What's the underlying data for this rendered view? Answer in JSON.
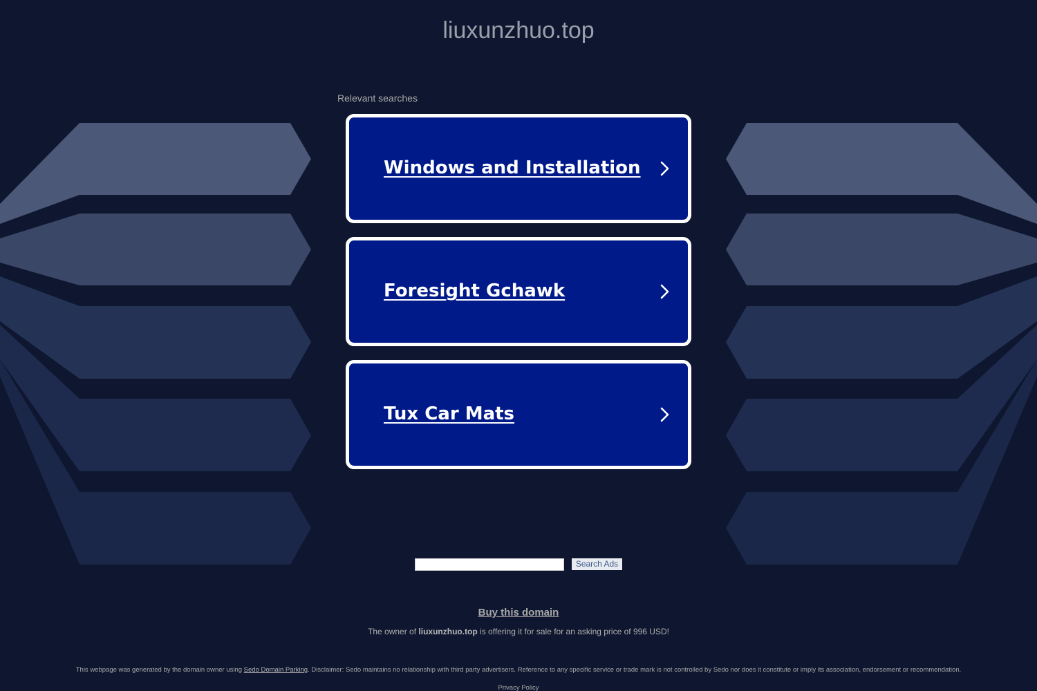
{
  "header": {
    "domain_title": "liuxunzhuo.top"
  },
  "relevant_searches": {
    "label": "Relevant searches",
    "items": [
      {
        "label": "Windows and Installation",
        "icon": "chevron-right-icon"
      },
      {
        "label": "Foresight Gchawk",
        "icon": "chevron-right-icon"
      },
      {
        "label": "Tux Car Mats",
        "icon": "chevron-right-icon"
      }
    ]
  },
  "search": {
    "input_value": "",
    "button_label": "Search Ads"
  },
  "sale": {
    "buy_link": "Buy this domain",
    "text_prefix": "The owner of ",
    "domain": "liuxunzhuo.top",
    "text_suffix": " is offering it for sale for an asking price of 996 USD!"
  },
  "footer": {
    "disclaimer_prefix": "This webpage was generated by the domain owner using ",
    "disclaimer_link": "Sedo Domain Parking",
    "disclaimer_suffix": ". Disclaimer: Sedo maintains no relationship with third party advertisers. Reference to any specific service or trade mark is not controlled by Sedo nor does it constitute or imply its association, endorsement or recommendation.",
    "privacy_link": "Privacy Policy"
  },
  "colors": {
    "background": "#0e172f",
    "card_background": "#001a8a",
    "card_border": "#ffffff",
    "muted_text": "#a8a8a8"
  }
}
